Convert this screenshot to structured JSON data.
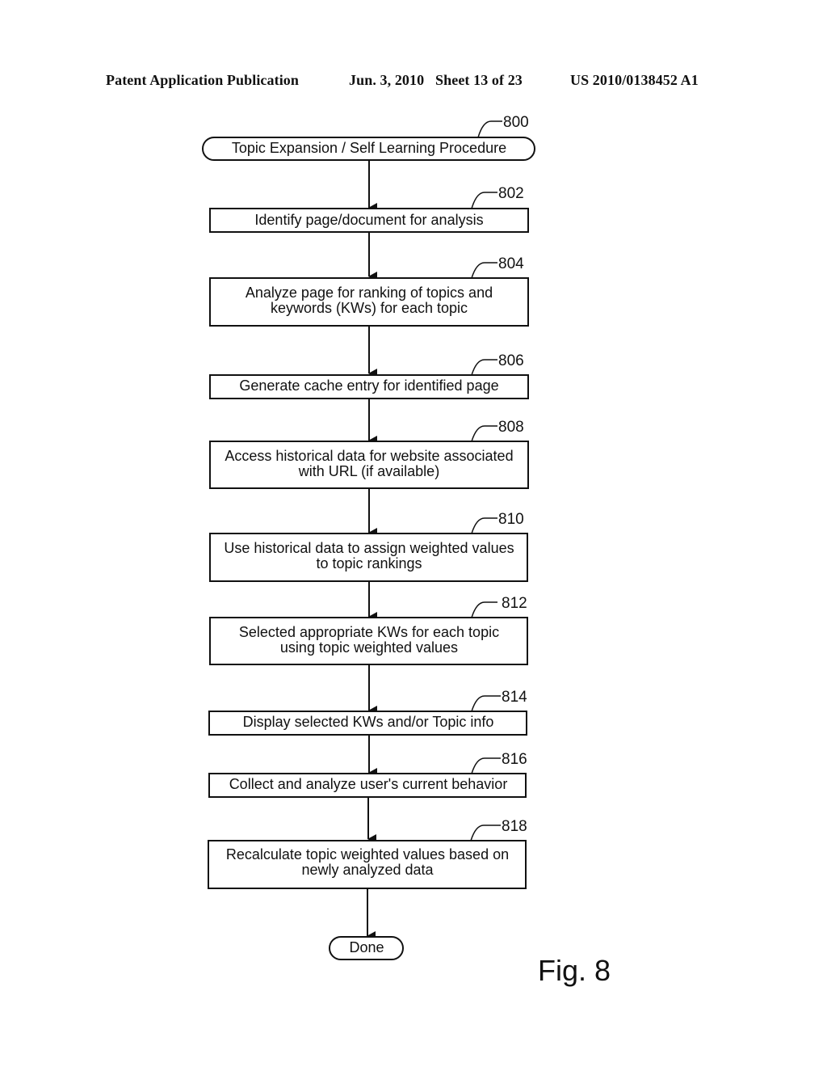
{
  "header": {
    "publication": "Patent Application Publication",
    "date_sheet": "Jun. 3, 2010   Sheet 13 of 23",
    "patent_number": "US 2010/0138452 A1"
  },
  "figure": {
    "label": "Fig. 8",
    "start": {
      "ref": "800",
      "text": "Topic Expansion / Self Learning Procedure"
    },
    "steps": [
      {
        "ref": "802",
        "lines": [
          "Identify page/document for analysis"
        ]
      },
      {
        "ref": "804",
        "lines": [
          "Analyze page for ranking of topics and",
          "keywords (KWs) for each topic"
        ]
      },
      {
        "ref": "806",
        "lines": [
          "Generate cache entry for identified page"
        ]
      },
      {
        "ref": "808",
        "lines": [
          "Access historical data for website associated",
          "with URL (if available)"
        ]
      },
      {
        "ref": "810",
        "lines": [
          "Use historical data to assign weighted values",
          "to topic rankings"
        ]
      },
      {
        "ref": "812",
        "lines": [
          "Selected appropriate KWs for each topic",
          "using topic weighted values"
        ]
      },
      {
        "ref": "814",
        "lines": [
          "Display selected KWs and/or Topic info"
        ]
      },
      {
        "ref": "816",
        "lines": [
          "Collect and analyze user's current behavior"
        ]
      },
      {
        "ref": "818",
        "lines": [
          "Recalculate topic weighted values based on",
          "newly analyzed data"
        ]
      }
    ],
    "end": {
      "text": "Done"
    }
  }
}
